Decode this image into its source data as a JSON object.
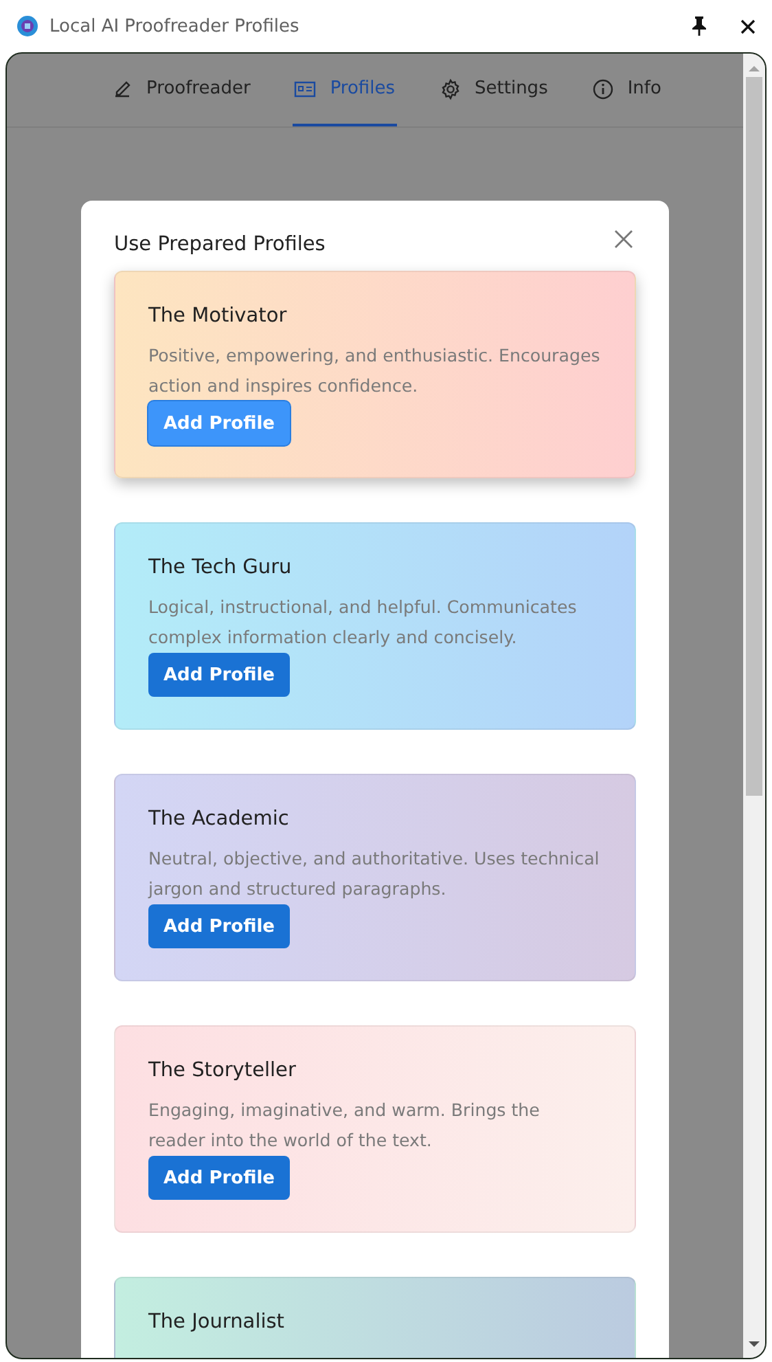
{
  "window": {
    "title": "Local AI Proofreader Profiles"
  },
  "tabs": [
    {
      "label": "Proofreader",
      "selected": false
    },
    {
      "label": "Profiles",
      "selected": true
    },
    {
      "label": "Settings",
      "selected": false
    },
    {
      "label": "Info",
      "selected": false
    }
  ],
  "dialog": {
    "title": "Use Prepared Profiles",
    "profiles": [
      {
        "name": "The Motivator",
        "description": "Positive, empowering, and enthusiastic. Encourages action and inspires confidence.",
        "button": "Add Profile",
        "hovered": true,
        "color": "#fde5c0"
      },
      {
        "name": "The Tech Guru",
        "description": "Logical, instructional, and helpful. Communicates complex information clearly and concisely.",
        "button": "Add Profile",
        "hovered": false,
        "color": "#b3ecf8"
      },
      {
        "name": "The Academic",
        "description": "Neutral, objective, and authoritative. Uses technical jargon and structured paragraphs.",
        "button": "Add Profile",
        "hovered": false,
        "color": "#d3d6f5"
      },
      {
        "name": "The Storyteller",
        "description": "Engaging, imaginative, and warm. Brings the reader into the world of the text.",
        "button": "Add Profile",
        "hovered": false,
        "color": "#fddfe2"
      },
      {
        "name": "The Journalist",
        "hovered": false,
        "color": "#c3eee0"
      }
    ]
  }
}
